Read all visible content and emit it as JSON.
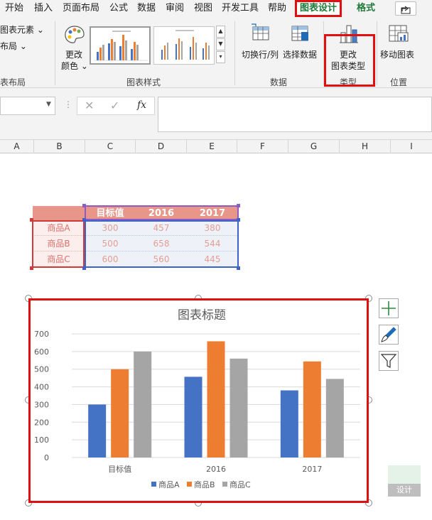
{
  "ribbon": {
    "tabs": [
      "开始",
      "插入",
      "页面布局",
      "公式",
      "数据",
      "审阅",
      "视图",
      "开发工具",
      "帮助",
      "图表设计",
      "格式"
    ],
    "active_tab": "图表设计",
    "add_chart_element": "图表元素",
    "quick_layout": "布局",
    "change_colors_line1": "更改",
    "change_colors_line2": "颜色",
    "switch_row_col": "切换行/列",
    "select_data": "选择数据",
    "change_type_line1": "更改",
    "change_type_line2": "图表类型",
    "move_chart": "移动图表",
    "group_labels": {
      "layouts": "表布局",
      "styles": "图表样式",
      "data": "数据",
      "type": "类型",
      "location": "位置"
    }
  },
  "formula_bar": {
    "cancel": "✕",
    "enter": "✓",
    "fx": "fx",
    "value": ""
  },
  "columns": [
    "A",
    "B",
    "C",
    "D",
    "E",
    "F",
    "G",
    "H",
    "I"
  ],
  "table": {
    "headers": [
      "目标值",
      "2016",
      "2017"
    ],
    "rows": [
      {
        "label": "商品A",
        "values": [
          "300",
          "457",
          "380"
        ]
      },
      {
        "label": "商品B",
        "values": [
          "500",
          "658",
          "544"
        ]
      },
      {
        "label": "商品C",
        "values": [
          "600",
          "560",
          "445"
        ]
      }
    ]
  },
  "chart_data": {
    "type": "bar",
    "title": "图表标题",
    "categories": [
      "目标值",
      "2016",
      "2017"
    ],
    "series": [
      {
        "name": "商品A",
        "values": [
          300,
          457,
          380
        ],
        "color": "#4472c4"
      },
      {
        "name": "商品B",
        "values": [
          500,
          658,
          544
        ],
        "color": "#ed7d31"
      },
      {
        "name": "商品C",
        "values": [
          600,
          560,
          445
        ],
        "color": "#a5a5a5"
      }
    ],
    "ylim": [
      0,
      700
    ],
    "yticks": [
      "0",
      "100",
      "200",
      "300",
      "400",
      "500",
      "600",
      "700"
    ],
    "grid": true,
    "legend": "bottom"
  },
  "chart_side_buttons": [
    "plus-icon",
    "brush-icon",
    "filter-icon"
  ],
  "watermark": "设计"
}
